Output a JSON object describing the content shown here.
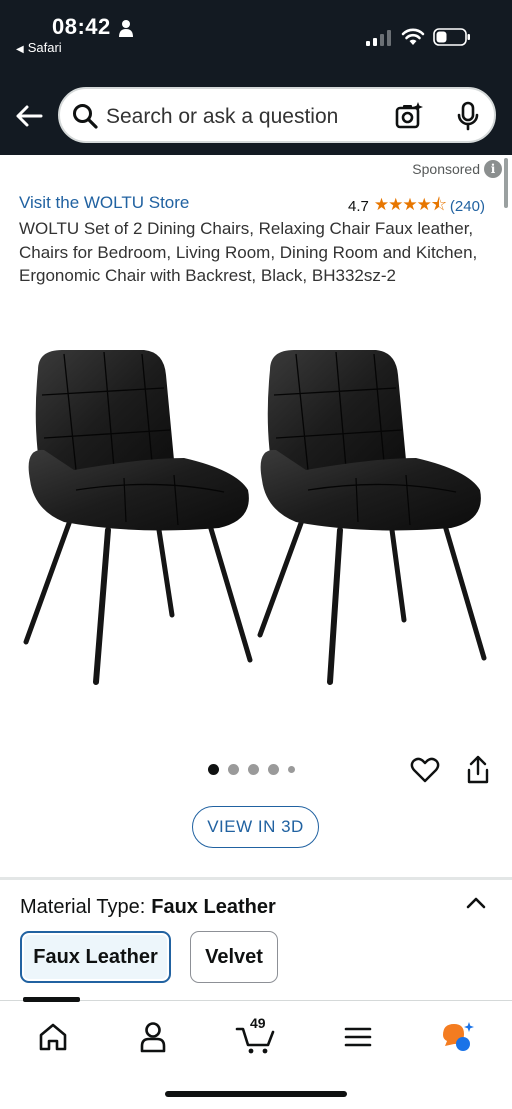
{
  "status_bar": {
    "time": "08:42",
    "back_app": "Safari"
  },
  "search": {
    "placeholder": "Search or ask a question"
  },
  "product": {
    "sponsored": "Sponsored",
    "store_link": "Visit the WOLTU Store",
    "rating_value": "4.7",
    "rating_stars": 4.7,
    "rating_count": "(240)",
    "title": "WOLTU Set of 2 Dining Chairs, Relaxing Chair Faux leather, Chairs for Bedroom, Living Room, Dining Room and Kitchen, Ergonomic Chair with Backrest, Black, BH332sz-2",
    "image_count": 5,
    "active_image": 1,
    "view_3d_label": "VIEW IN 3D"
  },
  "variation": {
    "label": "Material Type:",
    "selected": "Faux Leather",
    "options": [
      "Faux Leather",
      "Velvet"
    ]
  },
  "bottom_nav": {
    "cart_count": "49",
    "items": [
      "home-icon",
      "account-icon",
      "cart-icon",
      "menu-icon",
      "rufus-icon"
    ]
  },
  "colors": {
    "header_bg": "#131a22",
    "link": "#2162a1",
    "star": "#e77600",
    "rufus_orange": "#f47c20",
    "rufus_blue": "#1a73e8"
  }
}
